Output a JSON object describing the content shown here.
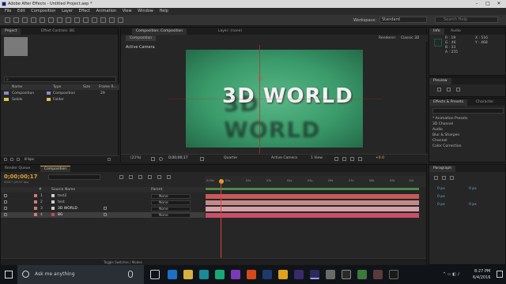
{
  "titlebar": {
    "title": "Adobe After Effects - Untitled Project.aep *"
  },
  "menu": [
    "File",
    "Edit",
    "Composition",
    "Layer",
    "Effect",
    "Animation",
    "View",
    "Window",
    "Help"
  ],
  "toolbar": {
    "workspace_label": "Workspace:",
    "workspace_value": "Standard",
    "search_placeholder": "Search Help"
  },
  "project_panel": {
    "tabs": [
      "Project",
      "Effect Controls: BG"
    ],
    "columns": [
      "Name",
      "Type",
      "Size",
      "Frame R..."
    ],
    "items": [
      {
        "name": "Composition",
        "type": "Composition",
        "size": "29",
        "color": "#8a8ac8"
      },
      {
        "name": "Solids",
        "type": "Folder",
        "size": "",
        "color": "#d8c850"
      }
    ],
    "footer": "8 bpc"
  },
  "comp_panel": {
    "tabs": [
      "Composition: Composition",
      "Layer: (none)"
    ],
    "subtab": "Composition",
    "renderer_label": "Renderer:",
    "renderer_value": "Classic 3D",
    "view_label": "Active Camera",
    "title_text": "3D WORLD",
    "bottom": {
      "zoom": "(21%)",
      "timecode": "0;00;00;17",
      "resolution": "Quarter",
      "camera": "Active Camera",
      "views": "1 View",
      "exposure": "+0.0"
    }
  },
  "info_panel": {
    "tabs": [
      "Info",
      "Audio"
    ],
    "r": "R : 19",
    "g": "G : 46",
    "b": "B : 33",
    "a": "A : 255",
    "x": "X : 516",
    "y": "Y : 468"
  },
  "preview_panel": {
    "tab": "Preview"
  },
  "effects_panel": {
    "tabs": [
      "Effects & Presets",
      "Character"
    ],
    "items": [
      "* Animation Presets",
      "3D Channel",
      "Audio",
      "Blur & Sharpen",
      "Channel",
      "Color Correction"
    ]
  },
  "timeline": {
    "tabs": [
      "Render Queue",
      "Composition"
    ],
    "timecode": "0;00;00;17",
    "fps": "00017 (29.97 fps)",
    "columns": [
      "#",
      "Source Name",
      "Parent"
    ],
    "layers": [
      {
        "num": "1",
        "name": "test2",
        "parent": "None",
        "color": "#d47a7a",
        "bar": "#c45a5a"
      },
      {
        "num": "2",
        "name": "test",
        "parent": "None",
        "color": "#d47a7a",
        "bar": "#c48a8a"
      },
      {
        "num": "3",
        "name": "3D WORLD",
        "parent": "None",
        "color": "#d47a7a",
        "bar": "#d4a0a8"
      },
      {
        "num": "4",
        "name": "BG",
        "parent": "None",
        "color": "#d47a7a",
        "bar": "#c8506a"
      }
    ],
    "ruler": [
      "0:00s",
      "01s",
      "02s",
      "03s",
      "04s",
      "05s",
      "06s",
      "07s",
      "08s",
      "09s",
      "10s"
    ],
    "footer": "Toggle Switches / Modes"
  },
  "paragraph_panel": {
    "tab": "Paragraph",
    "values": [
      "0 px",
      "0 px",
      "0 px",
      "0 px",
      "0 px"
    ]
  },
  "taskbar": {
    "search_placeholder": "Ask me anything",
    "time": "8:27 PM",
    "date": "6/4/2016"
  },
  "colors": {
    "comp_bg": "#3a9a6a",
    "accent": "#e0a030",
    "playhead": "#e04040"
  }
}
